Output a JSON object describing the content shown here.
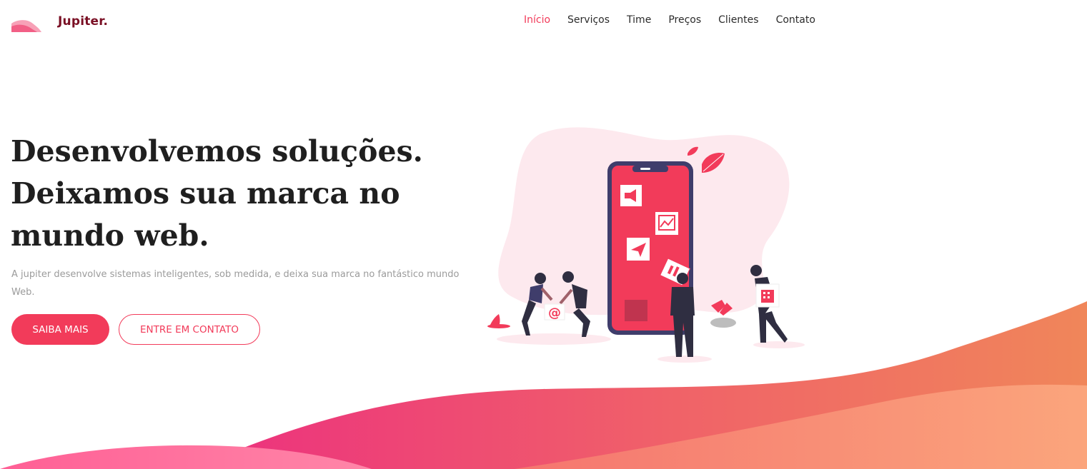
{
  "header": {
    "logo_text": "Jupiter.",
    "nav": [
      {
        "label": "Início",
        "active": true
      },
      {
        "label": "Serviços",
        "active": false
      },
      {
        "label": "Time",
        "active": false
      },
      {
        "label": "Preços",
        "active": false
      },
      {
        "label": "Clientes",
        "active": false
      },
      {
        "label": "Contato",
        "active": false
      }
    ]
  },
  "hero": {
    "headline_lines": [
      "Desenvolvemos soluções.",
      "Deixamos sua marca no",
      "mundo web."
    ],
    "subtitle": "A jupiter desenvolve sistemas inteligentes, sob medida, e deixa sua marca no fantástico mundo Web.",
    "primary_button": "SAIBA MAIS",
    "secondary_button": "ENTRE EM CONTATO",
    "illustration_glyph": "@"
  },
  "colors": {
    "accent": "#f23b5a",
    "logo": "#7a0f24",
    "text_dark": "#1f1f1f",
    "text_muted": "#9b9b9b",
    "wave_pink": "#ee3a7b",
    "wave_orange": "#f0865a"
  },
  "icons": [
    "logo-mark-icon",
    "megaphone-icon",
    "chart-icon",
    "paper-plane-icon",
    "building-icon",
    "leaf-icon"
  ]
}
